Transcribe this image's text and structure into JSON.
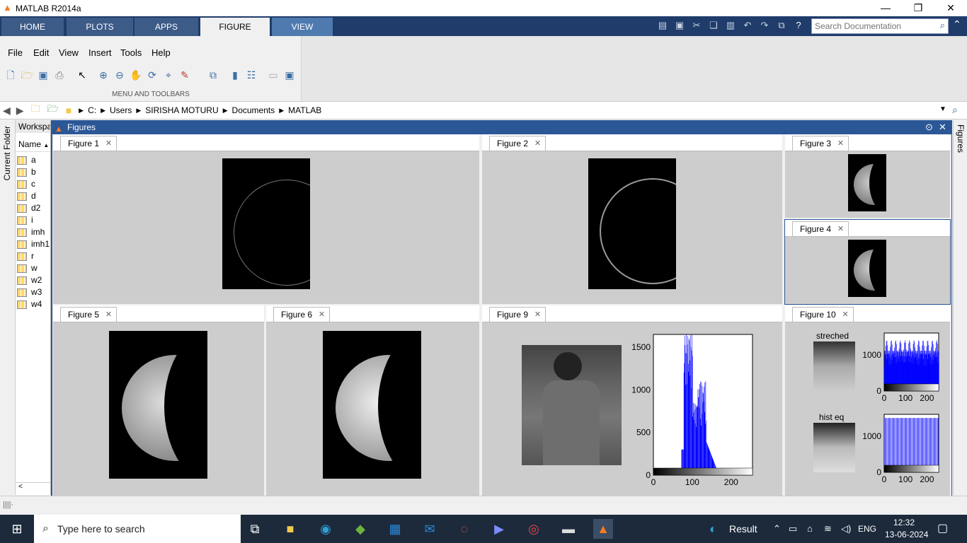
{
  "app": {
    "title": "MATLAB R2014a"
  },
  "ribbon": {
    "tabs": [
      "HOME",
      "PLOTS",
      "APPS",
      "FIGURE",
      "VIEW"
    ],
    "active": "FIGURE",
    "search_placeholder": "Search Documentation",
    "group_label": "MENU AND TOOLBARS"
  },
  "menu": [
    "File",
    "Edit",
    "View",
    "Insert",
    "Tools",
    "Help"
  ],
  "address": {
    "path": [
      "C:",
      "Users",
      "SIRISHA MOTURU",
      "Documents",
      "MATLAB"
    ]
  },
  "side": {
    "current_folder_label": "Current Folder",
    "figures_label": "Figures"
  },
  "workspace": {
    "title": "Workspace",
    "column": "Name",
    "variables": [
      "a",
      "b",
      "c",
      "d",
      "d2",
      "i",
      "imh",
      "imh1",
      "r",
      "w",
      "w2",
      "w3",
      "w4"
    ]
  },
  "figures_window": {
    "title": "Figures"
  },
  "figures": [
    {
      "label": "Figure 1"
    },
    {
      "label": "Figure 2"
    },
    {
      "label": "Figure 3"
    },
    {
      "label": "Figure 4"
    },
    {
      "label": "Figure 5"
    },
    {
      "label": "Figure 6"
    },
    {
      "label": "Figure 9"
    },
    {
      "label": "Figure 10"
    }
  ],
  "figure10": {
    "title1": "streched",
    "title2": "hist eq"
  },
  "chart_data": [
    {
      "type": "bar",
      "description_source": "Figure 9 histogram",
      "x_ticks": [
        "0",
        "100",
        "200"
      ],
      "y_ticks": [
        "0",
        "500",
        "1000",
        "1500"
      ],
      "xlim": [
        0,
        255
      ],
      "ylim": [
        0,
        1650
      ]
    },
    {
      "type": "bar",
      "title": "streched",
      "x_ticks": [
        "0",
        "100",
        "200"
      ],
      "y_ticks": [
        "0",
        "1000"
      ]
    },
    {
      "type": "bar",
      "title": "hist eq",
      "x_ticks": [
        "0",
        "100",
        "200"
      ],
      "y_ticks": [
        "0",
        "1000"
      ]
    }
  ],
  "taskbar": {
    "search_placeholder": "Type here to search",
    "weather": "Result",
    "lang": "ENG",
    "time": "12:32",
    "date": "13-06-2024"
  },
  "colors": {
    "ribbon": "#1f3c6b",
    "figure_header": "#2b5797",
    "histogram_bar": "#0000ff",
    "taskbar": "#1c2a3c"
  }
}
